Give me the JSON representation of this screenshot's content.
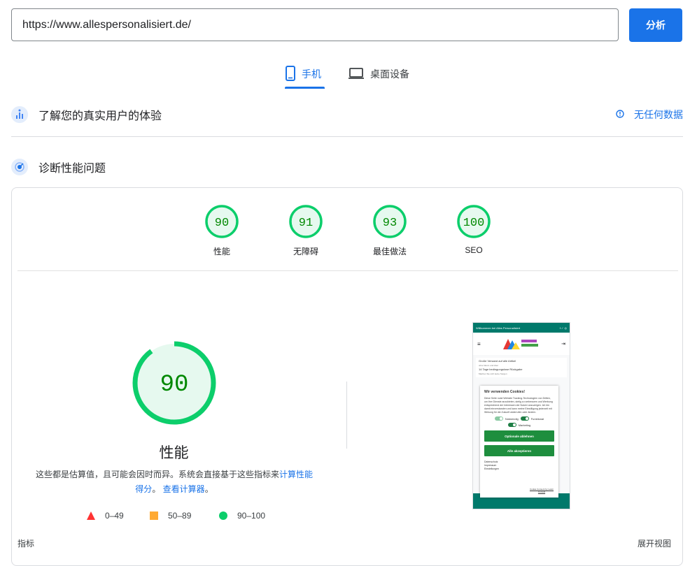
{
  "search": {
    "url": "https://www.allespersonalisiert.de/",
    "analyze_label": "分析"
  },
  "device_tabs": [
    {
      "label": "手机",
      "icon": "smartphone-icon",
      "active": true
    },
    {
      "label": "桌面设备",
      "icon": "laptop-icon",
      "active": false
    }
  ],
  "sections": {
    "field_data": {
      "title": "了解您的真实用户的体验",
      "status": "无任何数据",
      "icon": "field-data-icon"
    },
    "diagnose": {
      "title": "诊断性能问题",
      "icon": "lab-diagnose-icon"
    }
  },
  "categories": [
    {
      "score": "90",
      "label": "性能"
    },
    {
      "score": "91",
      "label": "无障碍"
    },
    {
      "score": "93",
      "label": "最佳做法"
    },
    {
      "score": "100",
      "label": "SEO"
    }
  ],
  "performance": {
    "score": "90",
    "title": "性能",
    "disclaimer_text": "这些都是估算值，且可能会因时而异。系统会直接基于这些指标来",
    "link_calc": "计算性能得分",
    "sep": "。",
    "link_calculator": "查看计算器",
    "end": "。"
  },
  "legend": [
    {
      "range": "0–49",
      "shape": "triangle",
      "color": "#ff3333"
    },
    {
      "range": "50–89",
      "shape": "square",
      "color": "#ffaa33"
    },
    {
      "range": "90–100",
      "shape": "circle",
      "color": "#0cce6b"
    }
  ],
  "colors": {
    "accent": "#1a73e8",
    "pass": "#0cce6b",
    "pass_text": "#008800",
    "pass_fill": "#e6f9ef"
  },
  "footer": {
    "metrics_label": "指标",
    "expand_label": "展开视图"
  },
  "screenshot": {
    "topbar": "Willkommen bei Alles Personalisiert",
    "promo1": "Große Versand auf alle Artikel",
    "promo1_sub": "ohne Wenn und Aber",
    "promo2": "14 Tage bedingungslose Rückgabe",
    "promo2_sub": "Machen Sie sich keine Sorgen",
    "cookie_title": "Wir verwenden Cookies!",
    "cookie_text": "Diese Seite nutzt Website Tracking-Technologien von Dritten, um ihre Dienste anzubieten, stetig zu verbessern und Werbung entsprechend der Interessen der Nutzer anzuzeigen. Ich bin damit einverstanden und kann meine Einwilligung jederzeit mit Wirkung für die Zukunft widerrufen oder ändern.",
    "toggle_necessary": "Notwendig",
    "toggle_functional": "Funktional",
    "toggle_marketing": "Marketing",
    "btn_reject": "Optionale ablehnen",
    "btn_accept": "Alle akzeptieren",
    "link_privacy": "Datenschutz",
    "link_imprint": "Impressum",
    "link_settings": "Einstellungen",
    "powered": "Cookie Consent by Lewin Consult"
  }
}
